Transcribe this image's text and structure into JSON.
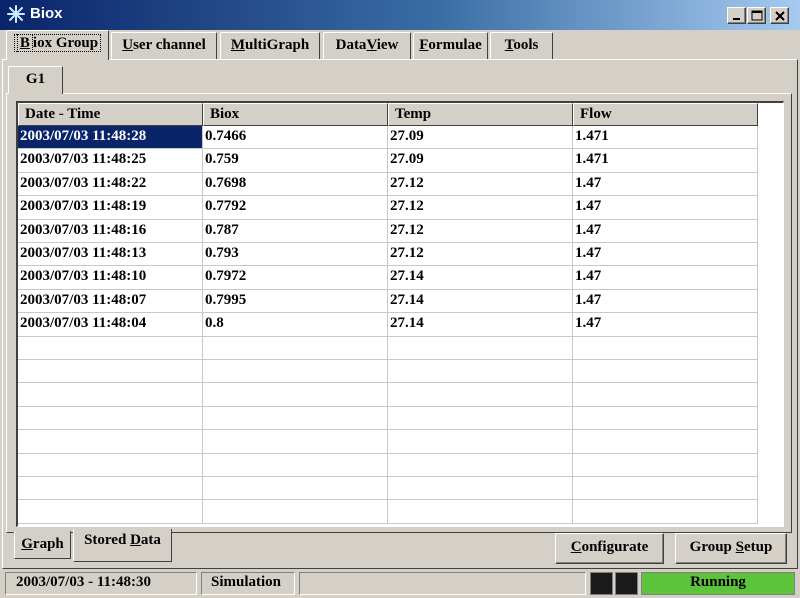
{
  "window": {
    "title": "Biox",
    "icon": "asterisk-icon",
    "buttons": [
      "minimize-icon",
      "maximize-icon",
      "close-icon"
    ]
  },
  "top_tabs": [
    {
      "label_ul": "B",
      "label_rest": "iox Group"
    },
    {
      "label_ul": "U",
      "label_rest": "ser channel"
    },
    {
      "label_ul": "M",
      "label_rest": "ultiGraph"
    },
    {
      "label_pre": "Data",
      "label_ul": "V",
      "label_rest": "iew"
    },
    {
      "label_ul": "F",
      "label_rest": "ormulae"
    },
    {
      "label_ul": "T",
      "label_rest": "ools"
    }
  ],
  "group_tab": "G1",
  "table": {
    "columns": [
      "Date - Time",
      "Biox",
      "Temp",
      "Flow"
    ],
    "rows": [
      [
        "2003/07/03 11:48:28",
        "0.7466",
        "27.09",
        "1.471"
      ],
      [
        "2003/07/03 11:48:25",
        "0.759",
        "27.09",
        "1.471"
      ],
      [
        "2003/07/03 11:48:22",
        "0.7698",
        "27.12",
        "1.47"
      ],
      [
        "2003/07/03 11:48:19",
        "0.7792",
        "27.12",
        "1.47"
      ],
      [
        "2003/07/03 11:48:16",
        "0.787",
        "27.12",
        "1.47"
      ],
      [
        "2003/07/03 11:48:13",
        "0.793",
        "27.12",
        "1.47"
      ],
      [
        "2003/07/03 11:48:10",
        "0.7972",
        "27.14",
        "1.47"
      ],
      [
        "2003/07/03 11:48:07",
        "0.7995",
        "27.14",
        "1.47"
      ],
      [
        "2003/07/03 11:48:04",
        "0.8",
        "27.14",
        "1.47"
      ]
    ],
    "selected_row": 0
  },
  "bottom_tabs": {
    "graph": {
      "label_ul": "G",
      "label_rest": "raph"
    },
    "stored": {
      "label_pre": "Stored ",
      "label_ul": "D",
      "label_rest": "ata"
    }
  },
  "buttons": {
    "configurate": {
      "label_ul": "C",
      "label_rest": "onfigurate"
    },
    "group_setup": {
      "label_pre": "Group ",
      "label_ul": "S",
      "label_rest": "etup"
    }
  },
  "status": {
    "time": "2003/07/03 - 11:48:30",
    "mode": "Simulation",
    "state": "Running"
  },
  "colors": {
    "selection": "#0a246a",
    "running": "#5cc43a",
    "face": "#d4d0c8"
  }
}
